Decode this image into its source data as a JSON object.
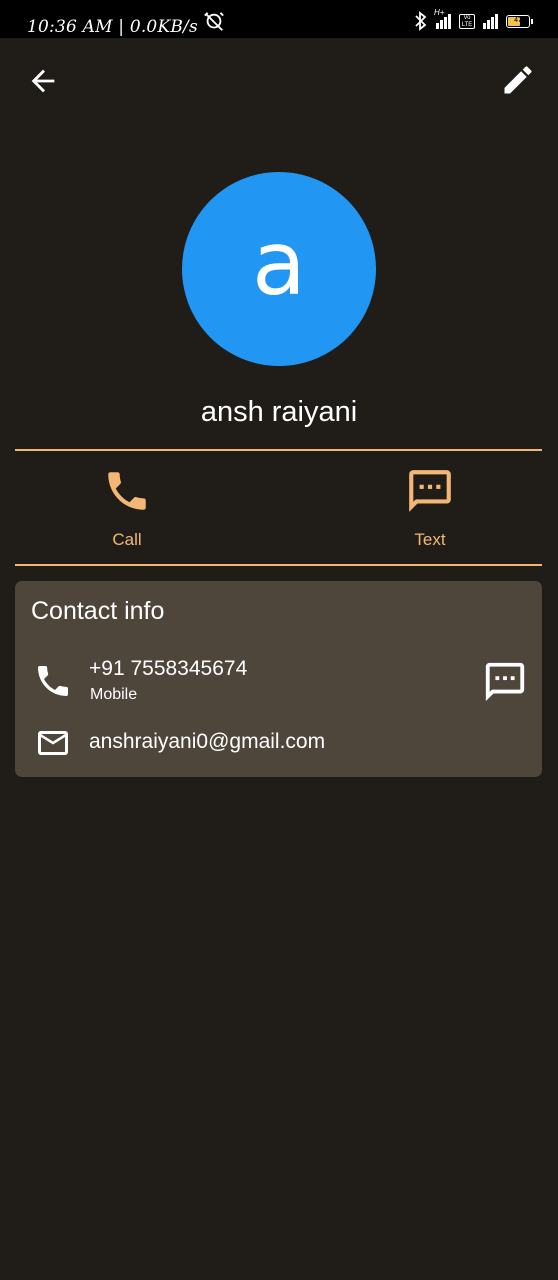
{
  "status_bar": {
    "time": "10:36 AM | 0.0KB/s",
    "icons": [
      "alarm-off-icon",
      "bluetooth-icon",
      "signal-hd-icon",
      "volte-icon",
      "signal-icon",
      "battery-icon"
    ],
    "battery_label": "47",
    "hd_label": "H+",
    "volte_label": "Vo LTE"
  },
  "toolbar": {
    "back_icon": "arrow-back-icon",
    "edit_icon": "pencil-icon"
  },
  "contact": {
    "avatar_letter": "a",
    "avatar_color": "#2196f3",
    "name": "ansh raiyani"
  },
  "actions": [
    {
      "label": "Call",
      "icon": "phone-icon"
    },
    {
      "label": "Text",
      "icon": "message-icon"
    }
  ],
  "contact_info": {
    "title": "Contact info",
    "phone": {
      "number": "+91 7558345674",
      "type": "Mobile"
    },
    "email": "anshraiyani0@gmail.com"
  },
  "colors": {
    "background": "#201d19",
    "accent": "#f2b774",
    "card": "#4e453b",
    "text": "#ffffff"
  }
}
